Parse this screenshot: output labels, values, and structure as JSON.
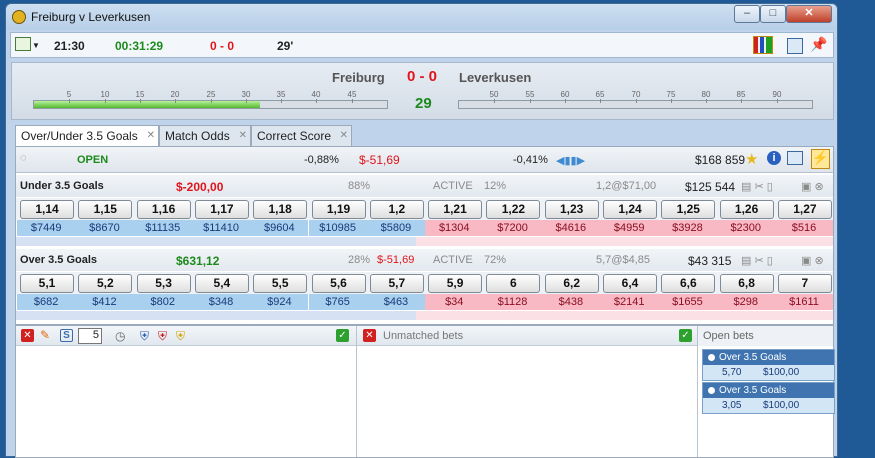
{
  "window": {
    "title": "Freiburg v Leverkusen"
  },
  "toolbar": {
    "clock": "21:30",
    "elapsed": "00:31:29",
    "score": "0 - 0",
    "minute": "29'"
  },
  "header": {
    "home_team": "Freiburg",
    "away_team": "Leverkusen",
    "score": "0 - 0",
    "minute": "29",
    "first_half_ticks": [
      "5",
      "10",
      "15",
      "20",
      "25",
      "30",
      "35",
      "40",
      "45"
    ],
    "second_half_ticks": [
      "50",
      "55",
      "60",
      "65",
      "70",
      "75",
      "80",
      "85",
      "90"
    ],
    "first_half_progress": 0.64,
    "second_half_progress": 0.0
  },
  "tabs": [
    "Over/Under 3.5 Goals",
    "Match Odds",
    "Correct Score"
  ],
  "status": {
    "state": "OPEN",
    "back_pct": "-0,88%",
    "pl": "$-51,69",
    "lay_pct": "-0,41%",
    "matched": "$168 859"
  },
  "markets": [
    {
      "name": "Under 3.5 Goals",
      "pl": "$-200,00",
      "pct": "88%",
      "state": "ACTIVE",
      "pct2": "12%",
      "last": "1,2@$71,00",
      "matched": "$125 544",
      "back_odds": [
        "1,14",
        "1,15",
        "1,16",
        "1,17",
        "1,18",
        "1,19",
        "1,2"
      ],
      "back_vols": [
        "$7449",
        "$8670",
        "$11135",
        "$11410",
        "$9604",
        "$10985",
        "$5809"
      ],
      "lay_odds": [
        "1,21",
        "1,22",
        "1,23",
        "1,24",
        "1,25",
        "1,26",
        "1,27"
      ],
      "lay_vols": [
        "$1304",
        "$7200",
        "$4616",
        "$4959",
        "$3928",
        "$2300",
        "$516"
      ]
    },
    {
      "name": "Over 3.5 Goals",
      "pl": "$631,12",
      "pct": "28%",
      "pl2": "$-51,69",
      "state": "ACTIVE",
      "pct2": "72%",
      "last": "5,7@$4,85",
      "matched": "$43 315",
      "back_odds": [
        "5,1",
        "5,2",
        "5,3",
        "5,4",
        "5,5",
        "5,6",
        "5,7"
      ],
      "back_vols": [
        "$682",
        "$412",
        "$802",
        "$348",
        "$924",
        "$765",
        "$463"
      ],
      "lay_odds": [
        "5,9",
        "6",
        "6,2",
        "6,4",
        "6,6",
        "6,8",
        "7"
      ],
      "lay_vols": [
        "$34",
        "$1128",
        "$438",
        "$2141",
        "$1655",
        "$298",
        "$1611"
      ]
    }
  ],
  "bet_panel": {
    "stake_selector": "5"
  },
  "unmatched": {
    "title": "Unmatched bets"
  },
  "open_bets": {
    "title": "Open bets",
    "bets": [
      {
        "selection": "Over 3.5 Goals",
        "odds": "5,70",
        "stake": "$100,00"
      },
      {
        "selection": "Over 3.5 Goals",
        "odds": "3,05",
        "stake": "$100,00"
      }
    ]
  },
  "colors": {
    "back": "#a9d0ee",
    "lay": "#f8b8c4",
    "loss": "#e0151b",
    "profit": "#1c8a1c"
  }
}
